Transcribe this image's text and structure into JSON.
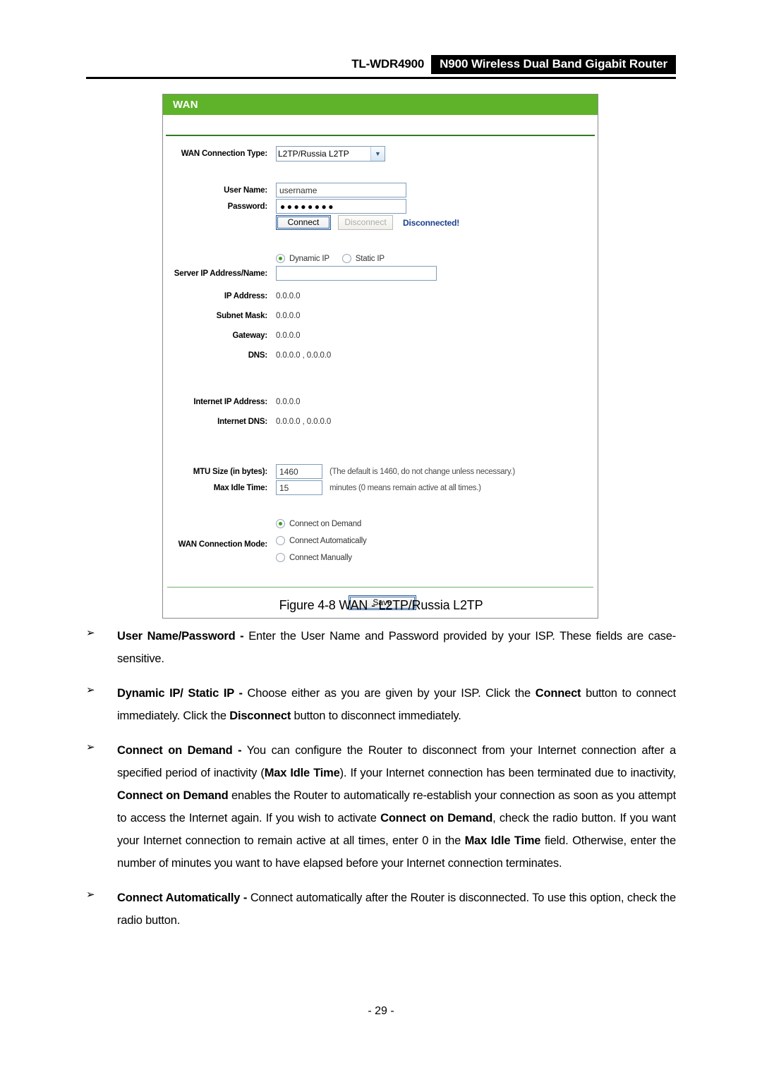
{
  "header": {
    "model": "TL-WDR4900",
    "product": "N900 Wireless Dual Band Gigabit Router"
  },
  "panel": {
    "title": "WAN",
    "wan_connection_type": {
      "label": "WAN Connection Type:",
      "value": "L2TP/Russia L2TP",
      "options": [
        "L2TP/Russia L2TP"
      ]
    },
    "user_name": {
      "label": "User Name:",
      "value": "username"
    },
    "password": {
      "label": "Password:",
      "value": "●●●●●●●●"
    },
    "connect_button": "Connect",
    "disconnect_button": "Disconnect",
    "status": "Disconnected!",
    "ip_mode": {
      "dynamic": "Dynamic IP",
      "static": "Static IP",
      "selected": "Dynamic IP"
    },
    "server_ip": {
      "label": "Server IP Address/Name:",
      "value": ""
    },
    "ip_address": {
      "label": "IP Address:",
      "value": "0.0.0.0"
    },
    "subnet_mask": {
      "label": "Subnet Mask:",
      "value": "0.0.0.0"
    },
    "gateway": {
      "label": "Gateway:",
      "value": "0.0.0.0"
    },
    "dns": {
      "label": "DNS:",
      "value": "0.0.0.0 , 0.0.0.0"
    },
    "internet_ip_address": {
      "label": "Internet IP Address:",
      "value": "0.0.0.0"
    },
    "internet_dns": {
      "label": "Internet DNS:",
      "value": "0.0.0.0 , 0.0.0.0"
    },
    "mtu_size": {
      "label": "MTU Size (in bytes):",
      "value": "1460",
      "hint": "(The default is 1460, do not change unless necessary.)"
    },
    "max_idle_time": {
      "label": "Max Idle Time:",
      "value": "15",
      "hint": "minutes (0 means remain active at all times.)"
    },
    "wan_connection_mode": {
      "label": "WAN Connection Mode:",
      "options": [
        "Connect on Demand",
        "Connect Automatically",
        "Connect Manually"
      ],
      "selected": "Connect on Demand"
    },
    "save_button": "Save",
    "accent_green": "#5fb32a",
    "status_color": "#1b3f8f",
    "radio_dot_color": "#3a9b1e"
  },
  "figure_caption": "Figure 4-8 WAN - L2TP/Russia L2TP",
  "bullets": [
    {
      "marker": "➢",
      "html": "<b>User Name/Password -</b> Enter the User Name and Password provided by your ISP. These fields are case-sensitive."
    },
    {
      "marker": "➢",
      "html": "<b>Dynamic IP/ Static IP -</b> Choose either as you are given by your ISP. Click the <b>Connect</b> button to connect immediately. Click the <b>Disconnect</b> button to disconnect immediately."
    },
    {
      "marker": "➢",
      "html": "<b>Connect on Demand -</b> You can configure the Router to disconnect from your Internet connection after a specified period of inactivity (<b>Max Idle Time</b>). If your Internet connection has been terminated due to inactivity, <b>Connect on Demand</b> enables the Router to automatically re-establish your connection as soon as you attempt to access the Internet again. If you wish to activate <b>Connect on Demand</b>, check the radio button. If you want your Internet connection to remain active at all times, enter 0 in the <b>Max Idle Time</b> field. Otherwise, enter the number of minutes you want to have elapsed before your Internet connection terminates."
    },
    {
      "marker": "➢",
      "html": "<b>Connect Automatically -</b> Connect automatically after the Router is disconnected. To use this option, check the radio button."
    }
  ],
  "page_number": "- 29 -"
}
